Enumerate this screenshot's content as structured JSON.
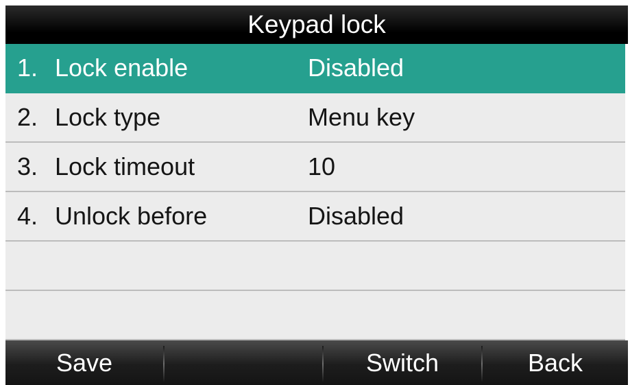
{
  "title": "Keypad lock",
  "items": [
    {
      "num": "1.",
      "label": "Lock enable",
      "value": "Disabled"
    },
    {
      "num": "2.",
      "label": "Lock type",
      "value": "Menu key"
    },
    {
      "num": "3.",
      "label": "Lock timeout",
      "value": "10"
    },
    {
      "num": "4.",
      "label": "Unlock before",
      "value": "Disabled"
    }
  ],
  "selected_index": 0,
  "softkeys": [
    "Save",
    "",
    "Switch",
    "Back"
  ],
  "colors": {
    "highlight": "#26a08f",
    "title_bg": "#000000",
    "row_bg": "#ececec",
    "softkey_bg": "#1d1d1d"
  }
}
